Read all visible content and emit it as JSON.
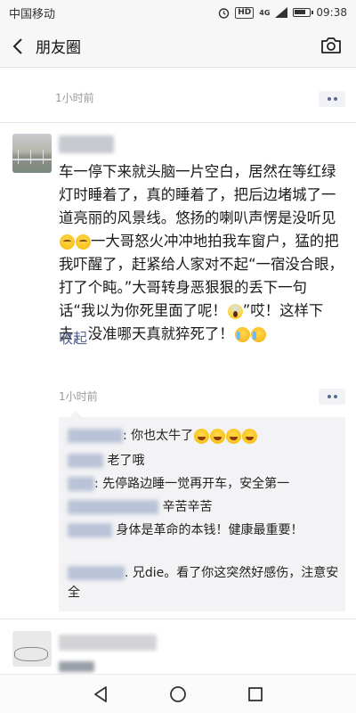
{
  "status_bar": {
    "carrier": "中国移动",
    "hd": "HD",
    "network": "4G",
    "time": "09:38",
    "battery_level": 0.8
  },
  "navbar": {
    "title": "朋友圈",
    "back_icon": "chevron-left-icon",
    "camera_icon": "camera-icon"
  },
  "previous_post": {
    "time": "1小时前"
  },
  "post": {
    "text": "车一停下来就头脑一片空白，居然在等红绿灯时睡着了，真的睡着了，把后边堵城了一道亮丽的风景线。悠扬的喇叭声愣是没听见",
    "text_mid": "一大哥怒火冲冲地拍我车窗户，猛的把我吓醒了，赶紧给人家对不起“一宿没合眼，打了个盹。”大哥转身恶狠狠的丢下一句话“我以为你死里面了呢！",
    "text_tail": "”哎！这样下去，没准哪天真就猝死了！",
    "collapse": "收起",
    "time": "1小时前"
  },
  "comments": [
    {
      "text": ": 你也太牛了"
    },
    {
      "text": "老了哦"
    },
    {
      "text": ": 先停路边睡一觉再开车，安全第一"
    },
    {
      "text": "辛苦辛苦"
    },
    {
      "text": "身体是革命的本钱！健康最重要！"
    },
    {
      "text": ". 兄die。看了你这突然好感伤，注意安全"
    }
  ],
  "colors": {
    "link": "#576b95",
    "comment_bg": "#f3f3f5"
  }
}
